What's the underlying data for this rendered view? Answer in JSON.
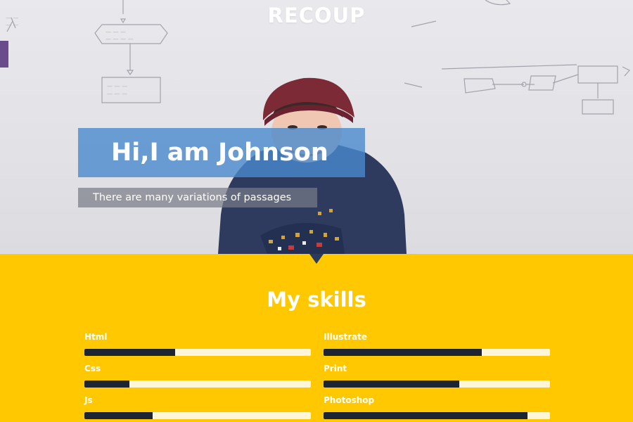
{
  "header": {
    "logo": "RECOUP"
  },
  "hero": {
    "headline": "Hi,I am Johnson",
    "subline": "There are many variations of passages"
  },
  "skills": {
    "title": "My skills",
    "items": [
      {
        "label": "Html",
        "level": 0.4
      },
      {
        "label": "Illustrate",
        "level": 0.7
      },
      {
        "label": "Css",
        "level": 0.2
      },
      {
        "label": "Print",
        "level": 0.6
      },
      {
        "label": "Js",
        "level": 0.3
      },
      {
        "label": "Photoshop",
        "level": 0.9
      }
    ]
  },
  "colors": {
    "skills_background": "#ffc800",
    "headline_box": "#4a8acd",
    "bar_fill": "#1d2533",
    "bar_track": "#fff6da"
  }
}
